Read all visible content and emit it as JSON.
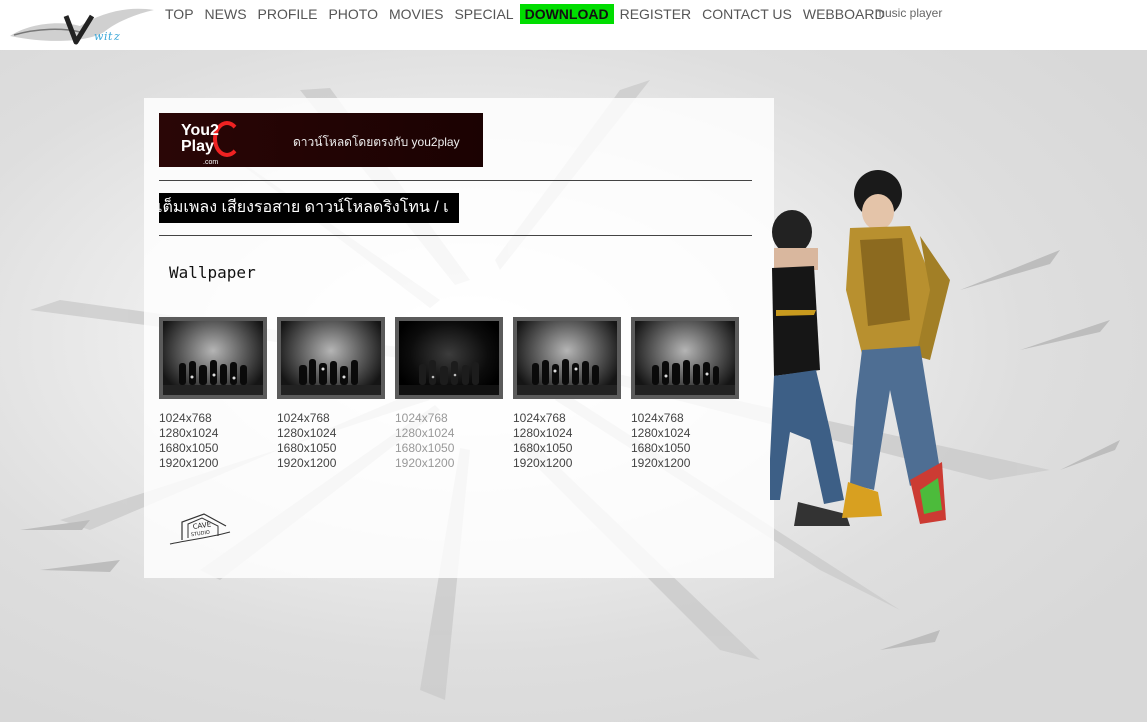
{
  "nav": {
    "items": [
      {
        "label": "TOP"
      },
      {
        "label": "NEWS"
      },
      {
        "label": "PROFILE"
      },
      {
        "label": "PHOTO"
      },
      {
        "label": "MOVIES"
      },
      {
        "label": "SPECIAL"
      },
      {
        "label": "DOWNLOAD",
        "active": true
      },
      {
        "label": "REGISTER"
      },
      {
        "label": "CONTACT US"
      },
      {
        "label": "WEBBOARD"
      }
    ],
    "music_player": "music player",
    "active_color": "#00dd00"
  },
  "banner": {
    "logo_text_line1": "You2",
    "logo_text_line2": "Play",
    "logo_text_com": ".com",
    "text": "ดาวน์โหลดโดยตรงกับ you2play"
  },
  "marquee": {
    "text": "เต็มเพลง เสียงรอสาย   ดาวน์โหลดริงโทน / เ"
  },
  "section": {
    "title": "Wallpaper"
  },
  "wallpapers": [
    {
      "sizes": [
        "1024x768",
        "1280x1024",
        "1680x1050",
        "1920x1200"
      ]
    },
    {
      "sizes": [
        "1024x768",
        "1280x1024",
        "1680x1050",
        "1920x1200"
      ]
    },
    {
      "sizes": [
        "1024x768",
        "1280x1024",
        "1680x1050",
        "1920x1200"
      ],
      "dim": true
    },
    {
      "sizes": [
        "1024x768",
        "1280x1024",
        "1680x1050",
        "1920x1200"
      ]
    },
    {
      "sizes": [
        "1024x768",
        "1280x1024",
        "1680x1050",
        "1920x1200"
      ]
    }
  ],
  "footer": {
    "studio_logo_line1": "CAVE",
    "studio_logo_line2": "STUDIO"
  }
}
